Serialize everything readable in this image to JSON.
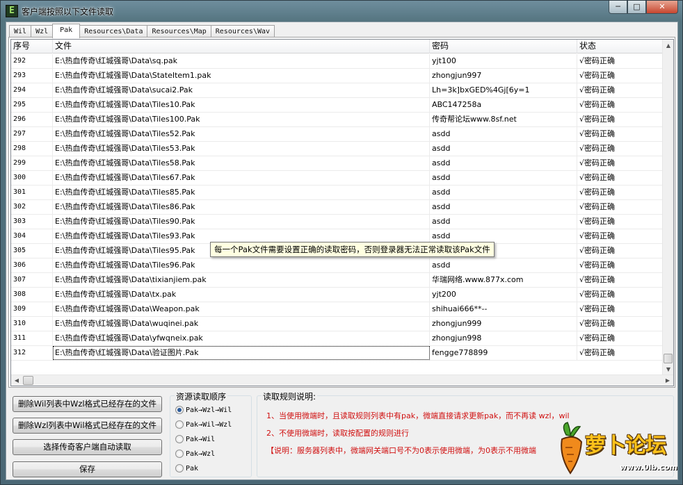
{
  "window": {
    "title": "客户端按照以下文件读取",
    "icon_letter": "E",
    "minimize": "─",
    "maximize": "□",
    "close": "✕"
  },
  "tabs": [
    {
      "label": "Wil"
    },
    {
      "label": "Wzl"
    },
    {
      "label": "Pak",
      "active": true
    },
    {
      "label": "Resources\\Data"
    },
    {
      "label": "Resources\\Map"
    },
    {
      "label": "Resources\\Wav"
    }
  ],
  "table": {
    "columns": [
      "序号",
      "文件",
      "密码",
      "状态"
    ],
    "rows": [
      {
        "id": "292",
        "file": "E:\\热血传奇\\红城强哥\\Data\\sq.pak",
        "password": "yjt100",
        "status": "√密码正确"
      },
      {
        "id": "293",
        "file": "E:\\热血传奇\\红城强哥\\Data\\StateItem1.pak",
        "password": "zhongjun997",
        "status": "√密码正确"
      },
      {
        "id": "294",
        "file": "E:\\热血传奇\\红城强哥\\Data\\sucai2.Pak",
        "password": "Lh=3k]bxGED%4Gj[6y=1",
        "status": "√密码正确"
      },
      {
        "id": "295",
        "file": "E:\\热血传奇\\红城强哥\\Data\\Tiles10.Pak",
        "password": "ABC147258a",
        "status": "√密码正确"
      },
      {
        "id": "296",
        "file": "E:\\热血传奇\\红城强哥\\Data\\Tiles100.Pak",
        "password": "传奇帮论坛www.8sf.net",
        "status": "√密码正确"
      },
      {
        "id": "297",
        "file": "E:\\热血传奇\\红城强哥\\Data\\Tiles52.Pak",
        "password": "asdd",
        "status": "√密码正确"
      },
      {
        "id": "298",
        "file": "E:\\热血传奇\\红城强哥\\Data\\Tiles53.Pak",
        "password": "asdd",
        "status": "√密码正确"
      },
      {
        "id": "299",
        "file": "E:\\热血传奇\\红城强哥\\Data\\Tiles58.Pak",
        "password": "asdd",
        "status": "√密码正确"
      },
      {
        "id": "300",
        "file": "E:\\热血传奇\\红城强哥\\Data\\Tiles67.Pak",
        "password": "asdd",
        "status": "√密码正确"
      },
      {
        "id": "301",
        "file": "E:\\热血传奇\\红城强哥\\Data\\Tiles85.Pak",
        "password": "asdd",
        "status": "√密码正确"
      },
      {
        "id": "302",
        "file": "E:\\热血传奇\\红城强哥\\Data\\Tiles86.Pak",
        "password": "asdd",
        "status": "√密码正确"
      },
      {
        "id": "303",
        "file": "E:\\热血传奇\\红城强哥\\Data\\Tiles90.Pak",
        "password": "asdd",
        "status": "√密码正确"
      },
      {
        "id": "304",
        "file": "E:\\热血传奇\\红城强哥\\Data\\Tiles93.Pak",
        "password": "asdd",
        "status": "√密码正确"
      },
      {
        "id": "305",
        "file": "E:\\热血传奇\\红城强哥\\Data\\Tiles95.Pak",
        "password": "",
        "status": "√密码正确"
      },
      {
        "id": "306",
        "file": "E:\\热血传奇\\红城强哥\\Data\\Tiles96.Pak",
        "password": "asdd",
        "status": "√密码正确"
      },
      {
        "id": "307",
        "file": "E:\\热血传奇\\红城强哥\\Data\\tixianjiem.pak",
        "password": "华瑞网络.www.877x.com",
        "status": "√密码正确"
      },
      {
        "id": "308",
        "file": "E:\\热血传奇\\红城强哥\\Data\\tx.pak",
        "password": "yjt200",
        "status": "√密码正确"
      },
      {
        "id": "309",
        "file": "E:\\热血传奇\\红城强哥\\Data\\Weapon.pak",
        "password": "shihuai666**--",
        "status": "√密码正确"
      },
      {
        "id": "310",
        "file": "E:\\热血传奇\\红城强哥\\Data\\wuqinei.pak",
        "password": "zhongjun999",
        "status": "√密码正确"
      },
      {
        "id": "311",
        "file": "E:\\热血传奇\\红城强哥\\Data\\yfwqneix.pak",
        "password": "zhongjun998",
        "status": "√密码正确"
      },
      {
        "id": "312",
        "file": "E:\\热血传奇\\红城强哥\\Data\\验证图片.Pak",
        "password": "fengge778899",
        "status": "√密码正确"
      }
    ]
  },
  "tooltip": "每一个Pak文件需要设置正确的读取密码，否则登录器无法正常读取该Pak文件",
  "buttons": {
    "delete_wil": "删除Wil列表中Wzl格式已经存在的文件",
    "delete_wzl": "删除Wzl列表中Wil格式已经存在的文件",
    "select_client": "选择传奇客户端自动读取",
    "save": "保存"
  },
  "order_group": {
    "title": "资源读取顺序",
    "options": [
      "Pak→Wzl→Wil",
      "Pak→Wil→Wzl",
      "Pak→Wil",
      "Pak→Wzl",
      "Pak"
    ],
    "selected": 0
  },
  "rules": {
    "title": "读取规则说明:",
    "line1": "1、当使用微端时，且读取规则列表中有pak，微端直接请求更新pak，而不再读 wzl，wil",
    "line2": "2、不使用微端时，读取按配置的规则进行",
    "line3": "【说明：服务器列表中，微端网关端口号不为0表示使用微端，为0表示不用微端"
  },
  "watermark": {
    "text": "萝卜论坛",
    "url": "www.0lb.com"
  },
  "colors": {
    "rule_text": "#d01010",
    "tooltip_bg": "#ffffe1",
    "watermark": "#ffc21a"
  }
}
